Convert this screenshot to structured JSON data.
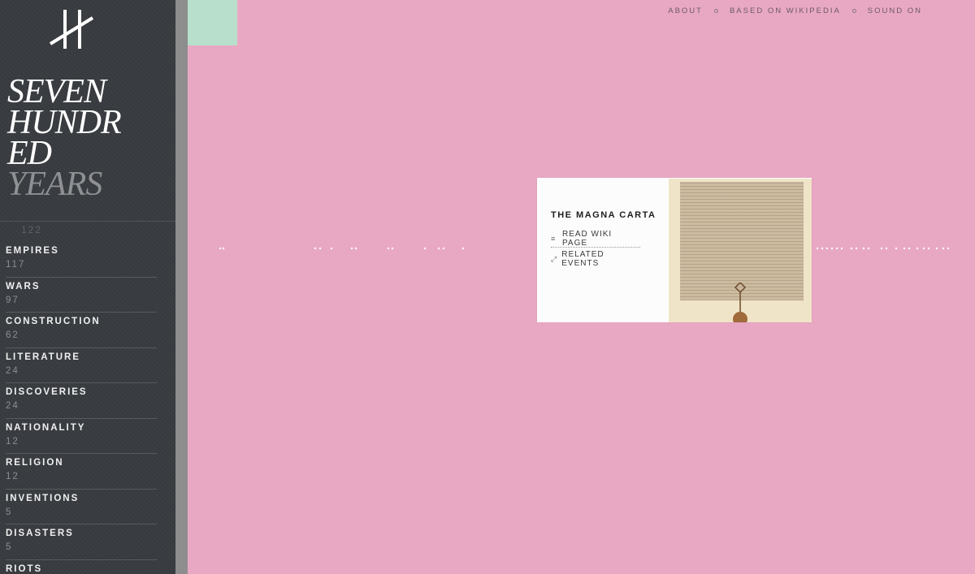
{
  "app": {
    "title_lines": [
      "SEVEN",
      "HUNDR",
      "ED"
    ],
    "title_dim": "YEARS",
    "cutoff": "122"
  },
  "categories": [
    {
      "name": "EMPIRES",
      "count": "117"
    },
    {
      "name": "WARS",
      "count": "97"
    },
    {
      "name": "CONSTRUCTION",
      "count": "62"
    },
    {
      "name": "LITERATURE",
      "count": "24"
    },
    {
      "name": "DISCOVERIES",
      "count": "24"
    },
    {
      "name": "NATIONALITY",
      "count": "12"
    },
    {
      "name": "RELIGION",
      "count": "12"
    },
    {
      "name": "INVENTIONS",
      "count": "5"
    },
    {
      "name": "DISASTERS",
      "count": "5"
    },
    {
      "name": "RIOTS",
      "count": ""
    }
  ],
  "nav": {
    "about": "ABOUT",
    "wiki": "BASED ON WIKIPEDIA",
    "sound": "SOUND ON"
  },
  "card": {
    "title": "THE MAGNA CARTA",
    "read_wiki": "READ WIKI PAGE",
    "related": "RELATED EVENTS"
  },
  "colors": {
    "background": "#e8a8c3",
    "sidebar": "#373a3e",
    "accent_square": "#b8dfcb"
  },
  "icons": {
    "logo": "logo-icon",
    "read": "list-icon",
    "related": "link-icon"
  }
}
